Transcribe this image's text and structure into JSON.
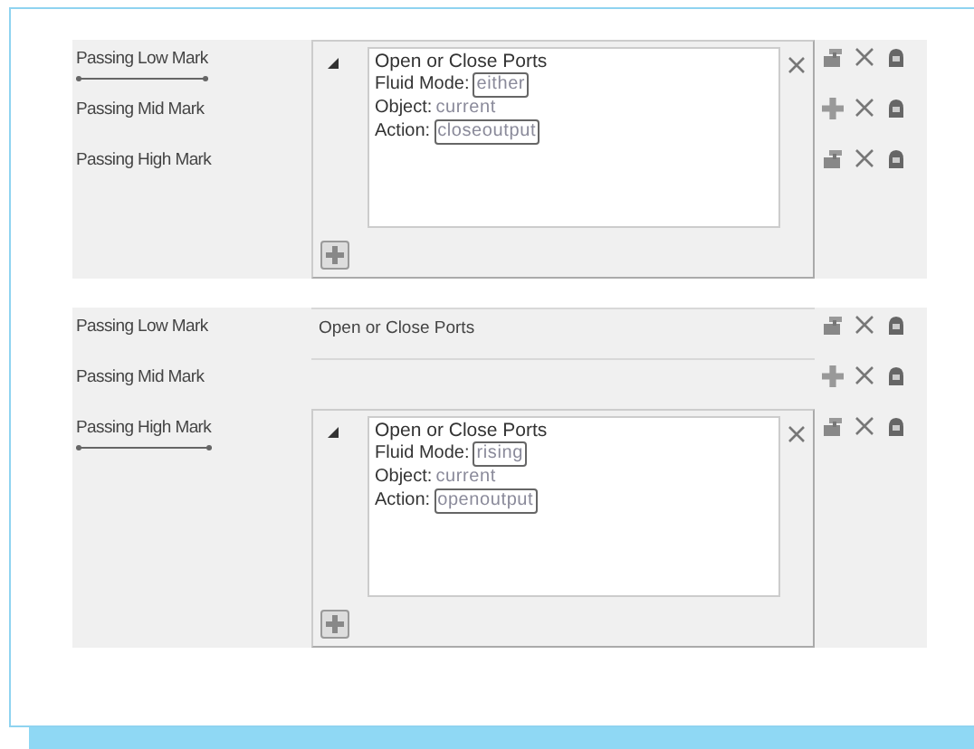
{
  "panels": [
    {
      "rows": [
        {
          "label": "Passing Low Mark",
          "selected": true,
          "kind": "edit"
        },
        {
          "label": "Passing Mid Mark",
          "selected": false,
          "kind": "add"
        },
        {
          "label": "Passing High Mark",
          "selected": false,
          "kind": "edit"
        }
      ],
      "editor": {
        "title": "Open or Close Ports",
        "fields": [
          {
            "label": "Fluid Mode:",
            "value": "either",
            "boxed": true
          },
          {
            "label": "Object:",
            "value": "current",
            "boxed": false
          },
          {
            "label": "Action:",
            "value": "closeoutput",
            "boxed": true
          }
        ]
      }
    },
    {
      "rows": [
        {
          "label": "Passing Low Mark",
          "selected": false,
          "kind": "edit",
          "summary": "Open or Close Ports"
        },
        {
          "label": "Passing Mid Mark",
          "selected": false,
          "kind": "add"
        },
        {
          "label": "Passing High Mark",
          "selected": true,
          "kind": "edit"
        }
      ],
      "editor": {
        "title": "Open or Close Ports",
        "fields": [
          {
            "label": "Fluid Mode:",
            "value": "rising",
            "boxed": true
          },
          {
            "label": "Object:",
            "value": "current",
            "boxed": false
          },
          {
            "label": "Action:",
            "value": "openoutput",
            "boxed": true
          }
        ]
      }
    }
  ]
}
